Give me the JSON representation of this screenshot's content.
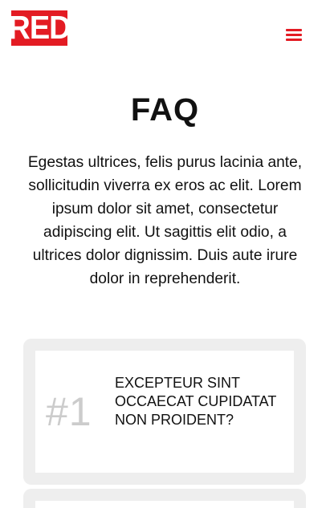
{
  "brand": {
    "logo_text": "RED",
    "accent_color": "#e31b23"
  },
  "header": {
    "menu_icon": "hamburger-menu-icon"
  },
  "page": {
    "title": "FAQ",
    "intro": "Egestas ultrices, felis purus lacinia ante, sollicitudin viverra ex eros ac elit. Lorem ipsum dolor sit amet, consectetur adipiscing elit. Ut sagittis elit odio, a ultrices dolor dignissim. Duis aute irure dolor in reprehenderit."
  },
  "faq": {
    "items": [
      {
        "number": "#1",
        "question": "EXCEPTEUR SINT OCCAECAT CUPIDATAT NON PROIDENT?"
      }
    ]
  }
}
